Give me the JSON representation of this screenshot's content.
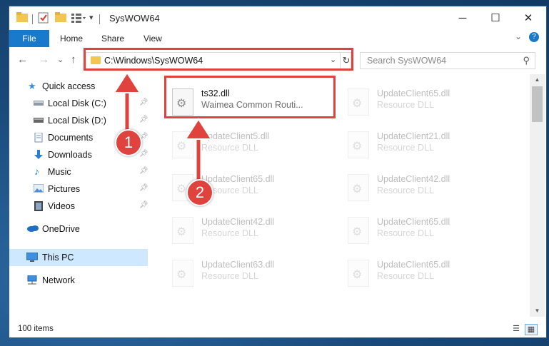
{
  "window": {
    "title": "SysWOW64",
    "minimize": "─",
    "maximize": "☐",
    "close": "✕"
  },
  "ribbon": {
    "tabs": [
      "File",
      "Home",
      "Share",
      "View"
    ],
    "collapse": "⌄",
    "help": "?"
  },
  "nav": {
    "back": "←",
    "forward": "→",
    "recent": "⌄",
    "up": "↑",
    "address": "C:\\Windows\\SysWOW64",
    "refresh": "↻",
    "search_placeholder": "Search SysWOW64"
  },
  "sidebar": {
    "items": [
      {
        "label": "Quick access",
        "icon": "star-icon"
      },
      {
        "label": "Local Disk (C:)",
        "icon": "drive-icon",
        "pinned": true
      },
      {
        "label": "Local Disk (D:)",
        "icon": "drive-icon",
        "pinned": true
      },
      {
        "label": "Documents",
        "icon": "documents-icon",
        "pinned": true
      },
      {
        "label": "Downloads",
        "icon": "downloads-icon",
        "pinned": true
      },
      {
        "label": "Music",
        "icon": "music-icon",
        "pinned": true
      },
      {
        "label": "Pictures",
        "icon": "pictures-icon",
        "pinned": true
      },
      {
        "label": "Videos",
        "icon": "videos-icon",
        "pinned": true
      },
      {
        "label": "OneDrive",
        "icon": "cloud-icon"
      },
      {
        "label": "This PC",
        "icon": "computer-icon",
        "selected": true
      },
      {
        "label": "Network",
        "icon": "network-icon"
      }
    ]
  },
  "files": [
    {
      "name": "ts32.dll",
      "desc": "Waimea Common Routi...",
      "highlight": true
    },
    {
      "name": "UpdateClient65.dll",
      "desc": "Resource DLL"
    },
    {
      "name": "UpdateClient5.dll",
      "desc": "Resource DLL"
    },
    {
      "name": "UpdateClient21.dll",
      "desc": "Resource DLL"
    },
    {
      "name": "UpdateClient65.dll",
      "desc": "Resource DLL"
    },
    {
      "name": "UpdateClient42.dll",
      "desc": "Resource DLL"
    },
    {
      "name": "UpdateClient42.dll",
      "desc": "Resource DLL"
    },
    {
      "name": "UpdateClient65.dll",
      "desc": "Resource DLL"
    },
    {
      "name": "UpdateClient63.dll",
      "desc": "Resource DLL"
    },
    {
      "name": "UpdateClient65.dll",
      "desc": "Resource DLL"
    }
  ],
  "status": {
    "item_count": "100 items"
  },
  "annotations": {
    "badge1": "1",
    "badge2": "2",
    "color": "#e0433d"
  },
  "colors": {
    "accent": "#1979ca",
    "selection": "#cde8ff"
  }
}
